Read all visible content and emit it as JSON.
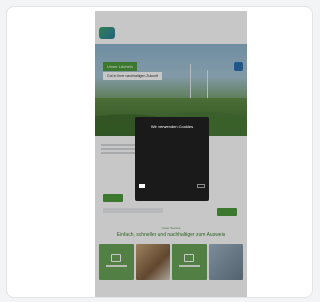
{
  "hero": {
    "tag": "Unser Lächeln",
    "subtitle": "Gut in Ihrer nachhaltigen Zukunft"
  },
  "section": {
    "kicker": "Unser Service",
    "title": "Einfach, schneller und nachhaltiger zum Ausweis"
  },
  "modal": {
    "title": "Wir verwenden Cookies"
  },
  "colors": {
    "brand_green": "#4f9a3d",
    "modal_bg": "#1a1a1a"
  }
}
